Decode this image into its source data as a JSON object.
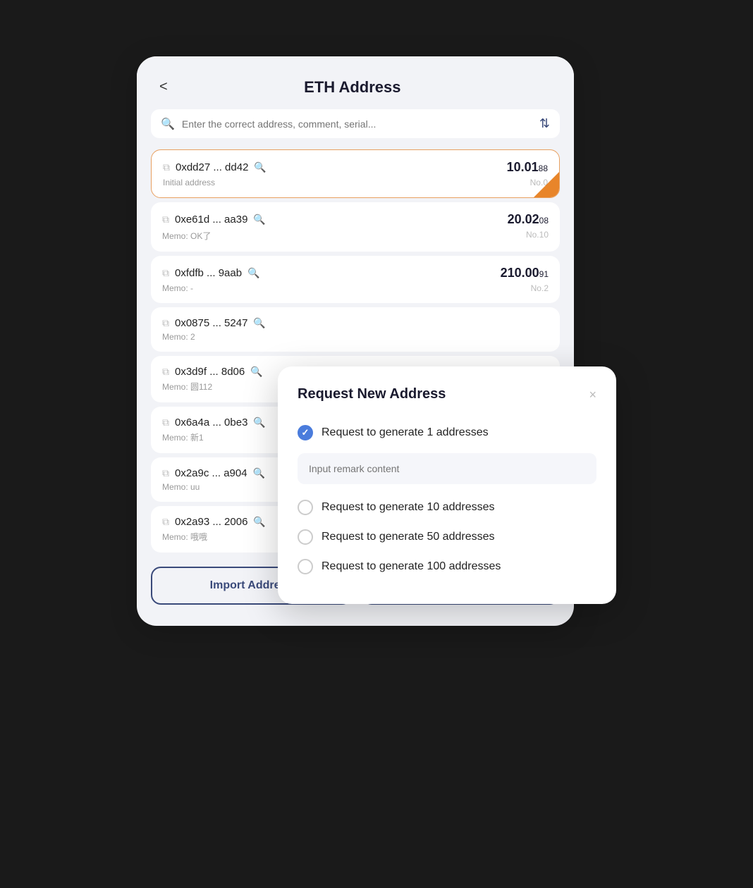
{
  "header": {
    "title": "ETH Address",
    "back_label": "<"
  },
  "search": {
    "placeholder": "Enter the correct address, comment, serial..."
  },
  "addresses": [
    {
      "hash": "0xdd27 ... dd42",
      "memo": "Initial address",
      "amount_whole": "10.01",
      "amount_decimal": "88",
      "no": "No.0",
      "active": true
    },
    {
      "hash": "0xe61d ... aa39",
      "memo": "Memo: OK了",
      "amount_whole": "20.02",
      "amount_decimal": "08",
      "no": "No.10",
      "active": false
    },
    {
      "hash": "0xfdfb ... 9aab",
      "memo": "Memo: -",
      "amount_whole": "210.00",
      "amount_decimal": "91",
      "no": "No.2",
      "active": false
    },
    {
      "hash": "0x0875 ... 5247",
      "memo": "Memo: 2",
      "amount_whole": "",
      "amount_decimal": "",
      "no": "",
      "active": false
    },
    {
      "hash": "0x3d9f ... 8d06",
      "memo": "Memo: 圆112",
      "amount_whole": "",
      "amount_decimal": "",
      "no": "",
      "active": false
    },
    {
      "hash": "0x6a4a ... 0be3",
      "memo": "Memo: 新1",
      "amount_whole": "",
      "amount_decimal": "",
      "no": "",
      "active": false
    },
    {
      "hash": "0x2a9c ... a904",
      "memo": "Memo: uu",
      "amount_whole": "",
      "amount_decimal": "",
      "no": "",
      "active": false
    },
    {
      "hash": "0x2a93 ... 2006",
      "memo": "Memo: 哦哦",
      "amount_whole": "",
      "amount_decimal": "",
      "no": "",
      "active": false
    }
  ],
  "buttons": {
    "import": "Import Address",
    "request": "Request New Address"
  },
  "modal": {
    "title": "Request New Address",
    "close_label": "×",
    "remark_placeholder": "Input remark content",
    "options": [
      {
        "label": "Request to generate 1 addresses",
        "checked": true
      },
      {
        "label": "Request to generate 10 addresses",
        "checked": false
      },
      {
        "label": "Request to generate 50 addresses",
        "checked": false
      },
      {
        "label": "Request to generate 100 addresses",
        "checked": false
      }
    ]
  }
}
